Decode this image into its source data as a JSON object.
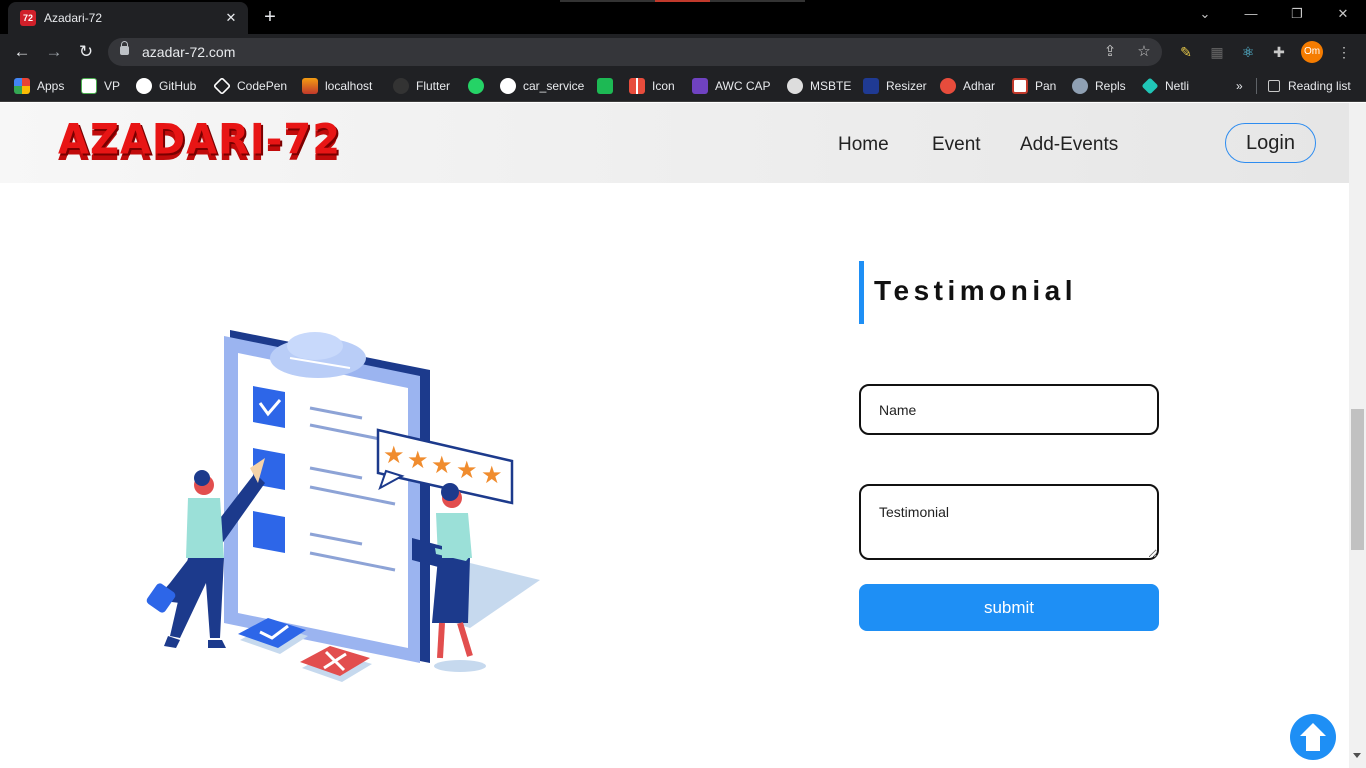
{
  "browser": {
    "tab_title": "Azadari-72",
    "tab_favicon_text": "72",
    "url": "azadar-72.com",
    "profile_initials": "Om",
    "bookmarks": [
      {
        "label": "Apps",
        "icon": "apps-grid-icon"
      },
      {
        "label": "VP",
        "icon": "vp-icon"
      },
      {
        "label": "GitHub",
        "icon": "github-icon"
      },
      {
        "label": "CodePen",
        "icon": "codepen-icon"
      },
      {
        "label": "localhost",
        "icon": "localhost-icon"
      },
      {
        "label": "Flutter",
        "icon": "flutter-icon"
      },
      {
        "label": "",
        "icon": "whatsapp-icon"
      },
      {
        "label": "car_service",
        "icon": "github-icon"
      },
      {
        "label": "",
        "icon": "green-app-icon"
      },
      {
        "label": "Icon",
        "icon": "icon-grid-icon"
      },
      {
        "label": "AWC CAP",
        "icon": "awc-icon"
      },
      {
        "label": "MSBTE",
        "icon": "msbte-icon"
      },
      {
        "label": "Resizer",
        "icon": "resizer-icon"
      },
      {
        "label": "Adhar",
        "icon": "adhar-icon"
      },
      {
        "label": "Pan",
        "icon": "nsdl-icon"
      },
      {
        "label": "Repls",
        "icon": "repls-icon"
      },
      {
        "label": "Netli",
        "icon": "netlify-icon"
      }
    ],
    "overflow": "»",
    "reading_list": "Reading list"
  },
  "site": {
    "logo_text": "AZADARI-72",
    "nav": {
      "home": "Home",
      "event": "Event",
      "add_events": "Add-Events",
      "login": "Login"
    },
    "form": {
      "heading": "Testimonial",
      "name_placeholder": "Name",
      "testimonial_placeholder": "Testimonial",
      "submit_label": "submit"
    },
    "accent_color": "#1e8ff5"
  }
}
